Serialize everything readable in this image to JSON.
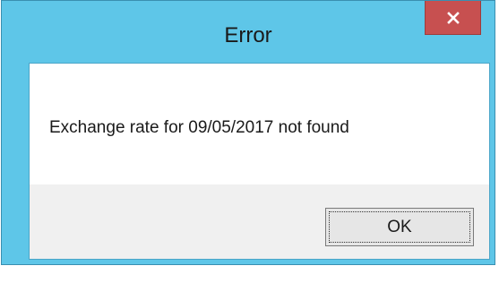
{
  "dialog": {
    "title": "Error",
    "message": "Exchange rate for 09/05/2017 not found",
    "ok_label": "OK",
    "close_icon": "close-icon"
  },
  "colors": {
    "titlebar": "#5ec6e8",
    "close_button": "#c75050",
    "message_background": "#ffffff",
    "button_area": "#f0f0f0"
  }
}
